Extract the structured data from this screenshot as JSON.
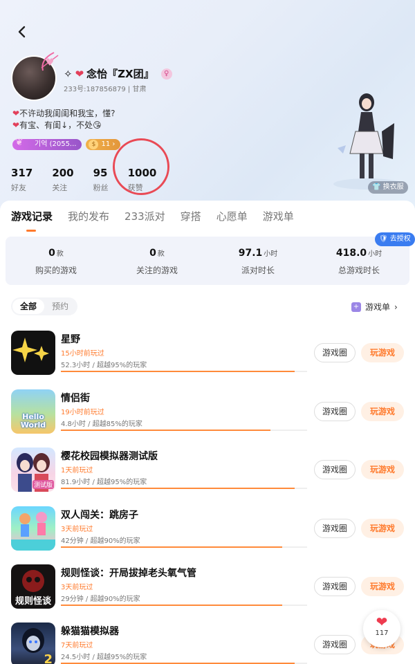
{
  "profile": {
    "back_icon": "chevron-left-icon",
    "name_prefix": "✧",
    "name": "念怡『ZX团』",
    "id_line": "233号:187856879",
    "location": "甘肃",
    "bio_line1": "不许动我闺闺和我宝，懂?",
    "bio_line2": "有宝、有闺↓，不处",
    "tag_label": "기억 (2055...",
    "tag2_label": "11",
    "dress_label": "换衣服"
  },
  "stats": [
    {
      "num": "317",
      "label": "好友"
    },
    {
      "num": "200",
      "label": "关注"
    },
    {
      "num": "95",
      "label": "粉丝"
    },
    {
      "num": "1000",
      "label": "获赞"
    }
  ],
  "tabs": [
    "游戏记录",
    "我的发布",
    "233派对",
    "穿搭",
    "心愿单",
    "游戏单"
  ],
  "summary": {
    "auth_label": "去授权",
    "items": [
      {
        "value": "0",
        "unit": "款",
        "label": "购买的游戏"
      },
      {
        "value": "0",
        "unit": "款",
        "label": "关注的游戏"
      },
      {
        "value": "97.1",
        "unit": "小时",
        "label": "派对时长"
      },
      {
        "value": "418.0",
        "unit": "小时",
        "label": "总游戏时长"
      }
    ]
  },
  "filter": {
    "all": "全部",
    "reserved": "预约",
    "gamelist": "游戏单"
  },
  "games": [
    {
      "title": "星野",
      "when": "15小时前玩过",
      "meta": "52.3小时 / 超越95%的玩家",
      "progress": 0.95
    },
    {
      "title": "情侣街",
      "when": "19小时前玩过",
      "meta": "4.8小时 / 超越85%的玩家",
      "progress": 0.85
    },
    {
      "title": "樱花校园模拟器测试版",
      "when": "1天前玩过",
      "meta": "81.9小时 / 超越95%的玩家",
      "progress": 0.95
    },
    {
      "title": "双人闯关：跳房子",
      "when": "3天前玩过",
      "meta": "42分钟 / 超越90%的玩家",
      "progress": 0.9
    },
    {
      "title": "规则怪谈：开局拔掉老头氧气管",
      "when": "3天前玩过",
      "meta": "29分钟 / 超越90%的玩家",
      "progress": 0.9
    },
    {
      "title": "躲猫猫模拟器",
      "when": "7天前玩过",
      "meta": "24.5小时 / 超越95%的玩家",
      "progress": 0.95
    }
  ],
  "game_buttons": {
    "circle": "游戏圈",
    "play": "玩游戏"
  },
  "thumb_texts": {
    "t2": "Hello World",
    "t3": "测试版",
    "t5": "规则怪谈",
    "t6": "2"
  },
  "like": {
    "count": "117"
  },
  "colors": {
    "accent": "#ff7a2c",
    "mark": "#e94a55",
    "auth": "#3a7cf0"
  }
}
